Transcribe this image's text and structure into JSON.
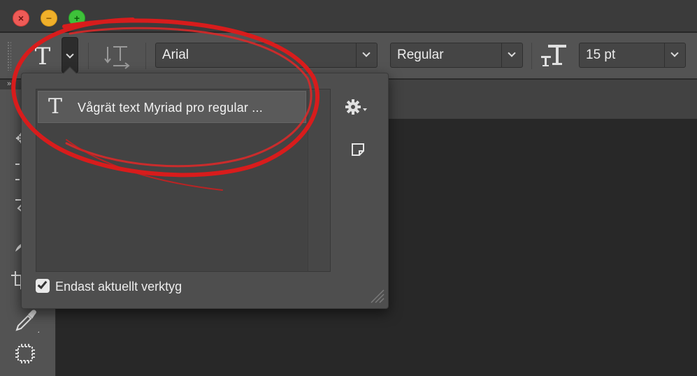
{
  "window": {
    "controls": [
      {
        "name": "close",
        "glyph": "×",
        "color": "#ee5b57"
      },
      {
        "name": "minimize",
        "glyph": "−",
        "color": "#f0b02a"
      },
      {
        "name": "maximize",
        "glyph": "+",
        "color": "#3ec23a"
      }
    ]
  },
  "options_bar": {
    "tool_glyph": "T",
    "orientation_icon": "vertical-text-orientation-icon",
    "font_family": "Arial",
    "font_style": "Regular",
    "size_icon": "font-size-icon",
    "font_size": "15 pt"
  },
  "toolbar": {
    "collapse_glyph": "»",
    "tools": [
      "move-tool-icon",
      "marquee-tool-icon",
      "lasso-tool-icon",
      "brush-tool-icon",
      "crop-tool-icon",
      "eyedropper-tool-icon",
      "frame-chip-tool-icon"
    ]
  },
  "preset_popup": {
    "items": [
      {
        "glyph": "T",
        "label": "Vågrät text Myriad pro regular ..."
      }
    ],
    "gear_icon": "gear-icon",
    "new_preset_icon": "new-preset-icon",
    "current_tool_only": {
      "checked": true,
      "label": "Endast aktuellt verktyg"
    }
  },
  "colors": {
    "annotation_red": "#d81c1c",
    "panel_bg": "#535353",
    "canvas_bg": "#282828"
  }
}
